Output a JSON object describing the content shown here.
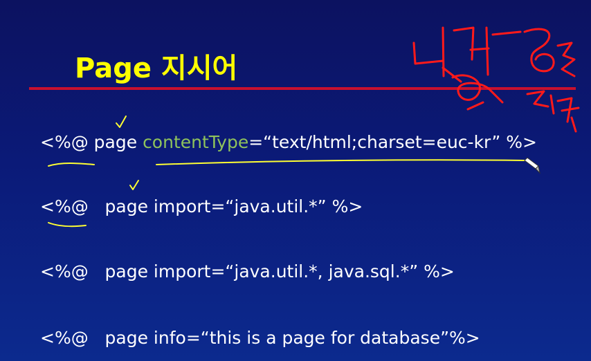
{
  "slide": {
    "title": "Page 지시어",
    "lines": [
      {
        "open": "<%@",
        "space": " ",
        "keyword": "page",
        "space2": " ",
        "attribute": "contentType",
        "rest": "=“text/html;charset=euc-kr” %>"
      },
      {
        "open": "<%@",
        "rest": "   page import=“java.util.*” %>"
      },
      {
        "open": "<%@",
        "rest": "   page import=“java.util.*, java.sql.*” %>"
      },
      {
        "open": "<%@",
        "rest": "   page info=“this is a page for database”%>"
      }
    ]
  },
  "colors": {
    "title": "#ffff00",
    "rule": "#c8102e",
    "attribute": "#8fc35c",
    "handwriting_red": "#ff1a1a",
    "handwriting_yellow": "#ffff33"
  }
}
